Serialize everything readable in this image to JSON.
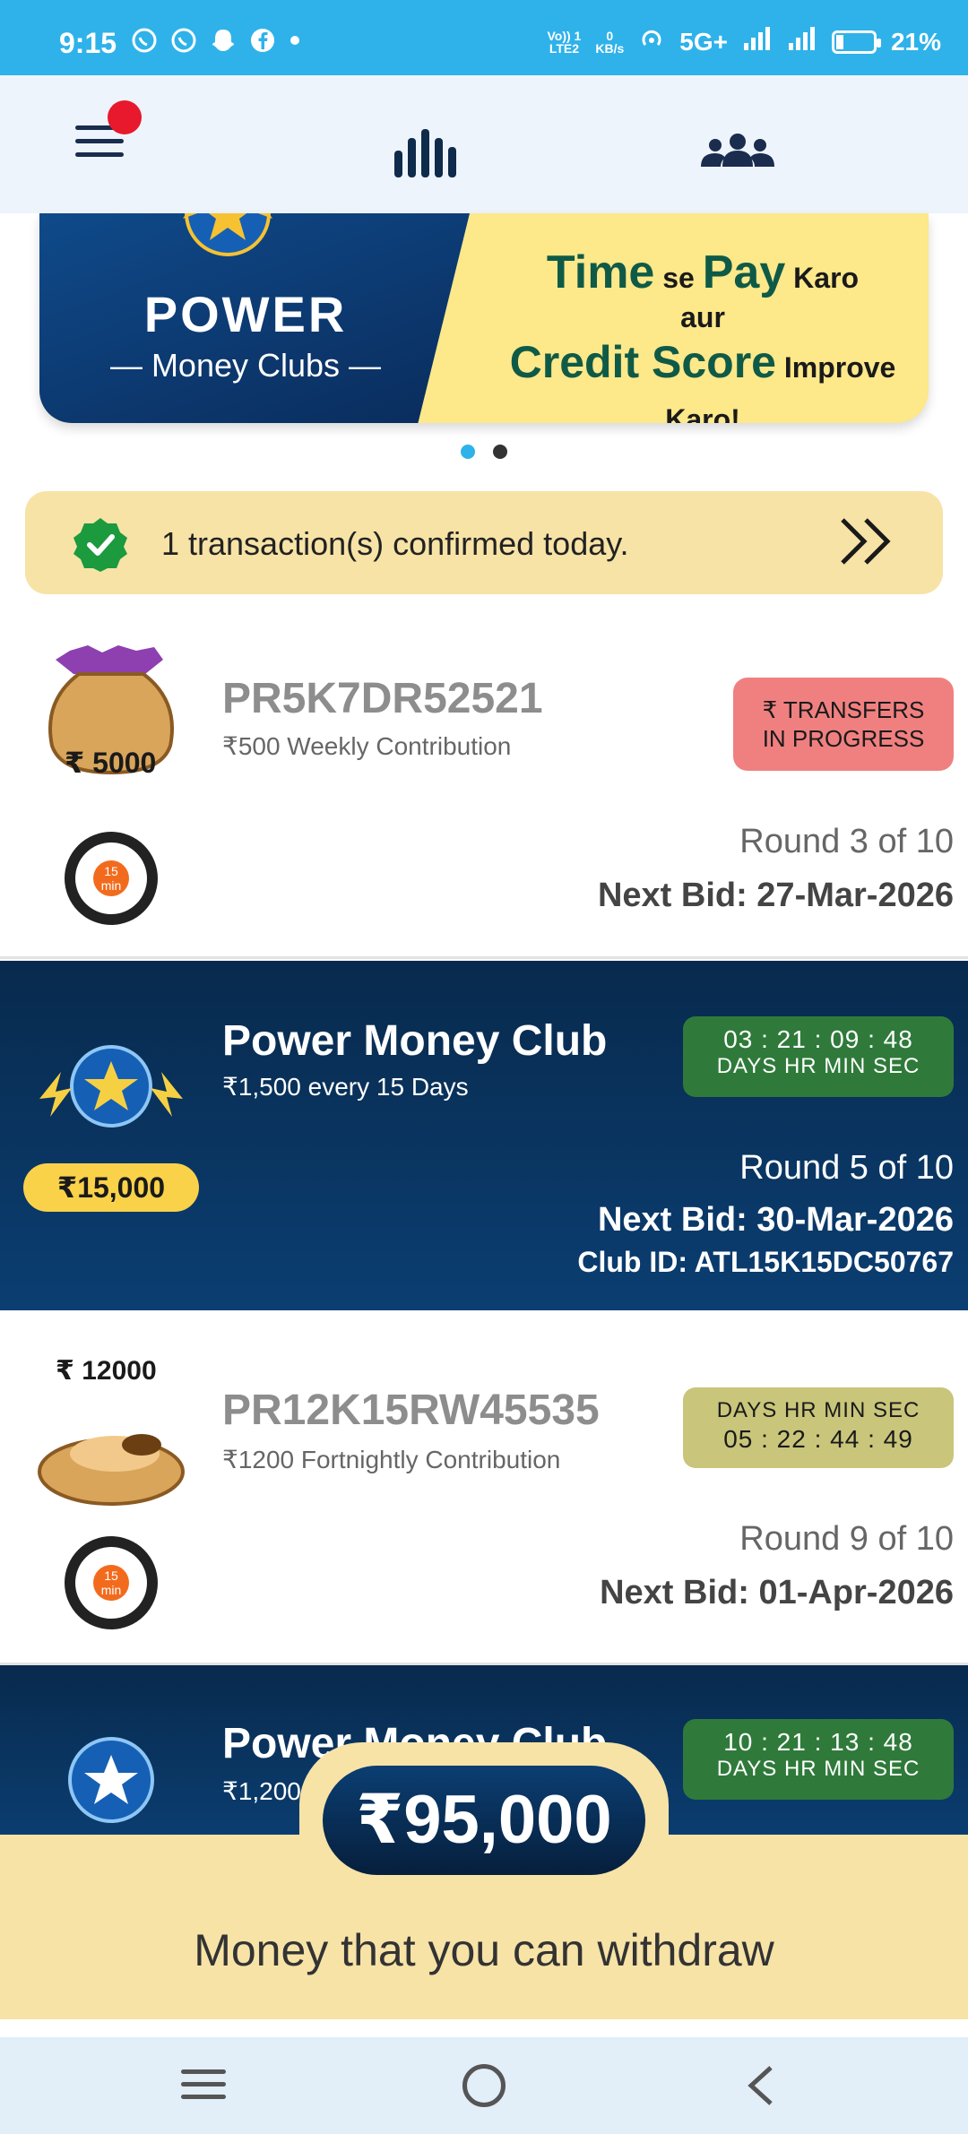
{
  "status_bar": {
    "time": "9:15",
    "network_label_top": "Vo)) 1",
    "network_label_bottom": "LTE2",
    "speed_top": "0",
    "speed_bottom": "KB/s",
    "signal_label": "5G+",
    "battery_percent": "21%",
    "battery_level": 0.21
  },
  "banner": {
    "brand_top": "POWER",
    "brand_bottom": "— Money Clubs —",
    "line1_a": "Time",
    "line1_b": " se ",
    "line1_c": "Pay",
    "line1_d": " Karo",
    "line2": "aur",
    "line3_a": "Credit Score",
    "line3_b": " Improve Karo!",
    "active_dot": 0
  },
  "notice": {
    "text": "1 transaction(s) confirmed today."
  },
  "clubs": [
    {
      "bag_amount": "₹ 5000",
      "title": "PR5K7DR52521",
      "subtitle": "₹500 Weekly Contribution",
      "status_line1": "₹ TRANSFERS",
      "status_line2": "IN PROGRESS",
      "round": "Round 3 of 10",
      "next_bid": "Next Bid: 27-Mar-2026",
      "timer_minutes_top": "15",
      "timer_minutes_bottom": "min"
    },
    {
      "pill_amount": "₹15,000",
      "title": "Power Money Club",
      "subtitle": "₹1,500 every 15 Days",
      "countdown": "03 : 21 : 09 : 48",
      "countdown_units": "DAYS  HR  MIN  SEC",
      "round": "Round 5 of 10",
      "next_bid": "Next Bid: 30-Mar-2026",
      "club_id": "Club ID: ATL15K15DC50767"
    },
    {
      "bag_amount": "₹ 12000",
      "title": "PR12K15RW45535",
      "subtitle": "₹1200 Fortnightly Contribution",
      "countdown_units": "DAYS  HR  MIN  SEC",
      "countdown": "05 : 22 : 44 : 49",
      "round": "Round 9 of 10",
      "next_bid": "Next Bid: 01-Apr-2026",
      "timer_minutes_top": "15",
      "timer_minutes_bottom": "min"
    },
    {
      "title": "Power Money Club",
      "subtitle": "₹1,200",
      "countdown": "10 : 21 : 13 : 48",
      "countdown_units": "DAYS  HR  MIN  SEC"
    }
  ],
  "withdraw": {
    "amount": "₹95,000",
    "label": "Money that you can withdraw"
  },
  "colors": {
    "status_bar": "#2fb2ea",
    "header_bg": "#eef4fb",
    "notice_bg": "#f7e3a6",
    "dark_card": "#082a4d",
    "transfer_pill": "#f08080",
    "timer_green": "#2f7a3a",
    "timer_olive": "#c9c57a"
  },
  "icons": {
    "header_left": "hamburger-menu-icon",
    "header_center": "leaderboard-bars-icon",
    "header_right": "people-group-icon",
    "notice_left": "verified-check-icon",
    "notice_right": "double-chevron-right-icon",
    "nav": [
      "recent-apps-icon",
      "home-circle-icon",
      "back-chevron-icon"
    ]
  }
}
